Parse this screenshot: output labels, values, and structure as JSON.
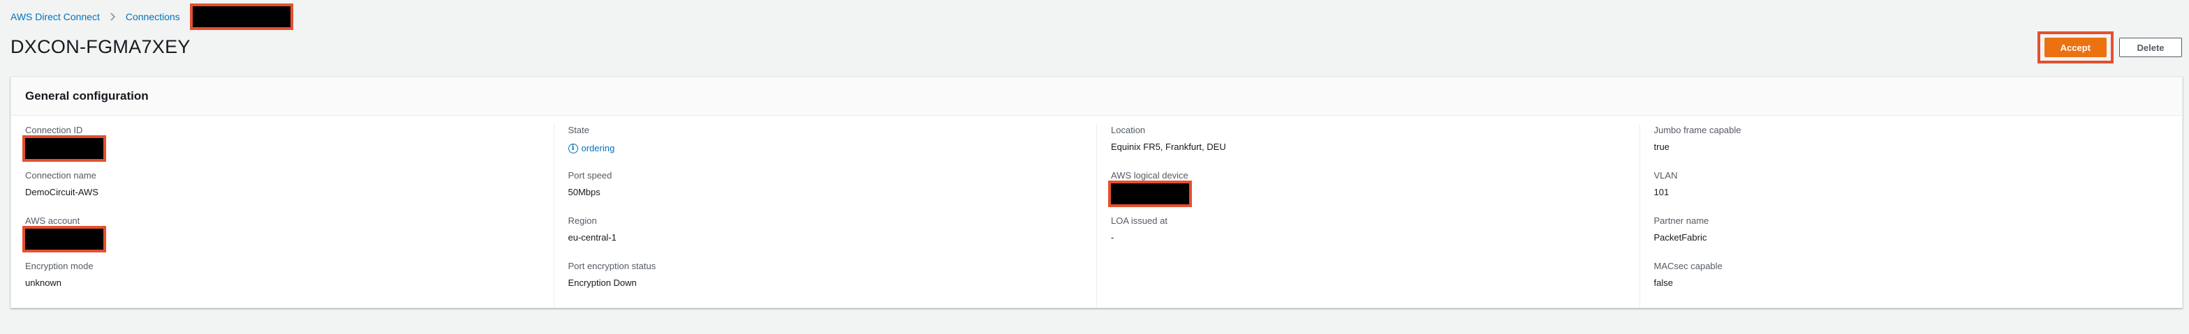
{
  "breadcrumb": {
    "items": [
      "AWS Direct Connect",
      "Connections"
    ]
  },
  "page": {
    "title": "DXCON-FGMA7XEY"
  },
  "actions": {
    "accept_label": "Accept",
    "delete_label": "Delete"
  },
  "panel": {
    "title": "General configuration",
    "columns": [
      [
        {
          "label": "Connection ID",
          "value": null,
          "redacted": true
        },
        {
          "label": "Connection name",
          "value": "DemoCircuit-AWS"
        },
        {
          "label": "AWS account",
          "value": null,
          "redacted": true
        },
        {
          "label": "Encryption mode",
          "value": "unknown"
        }
      ],
      [
        {
          "label": "State",
          "value": "ordering",
          "status": true
        },
        {
          "label": "Port speed",
          "value": "50Mbps"
        },
        {
          "label": "Region",
          "value": "eu-central-1"
        },
        {
          "label": "Port encryption status",
          "value": "Encryption Down"
        }
      ],
      [
        {
          "label": "Location",
          "value": "Equinix FR5, Frankfurt, DEU"
        },
        {
          "label": "AWS logical device",
          "value": null,
          "redacted": true
        },
        {
          "label": "LOA issued at",
          "value": "-"
        }
      ],
      [
        {
          "label": "Jumbo frame capable",
          "value": "true"
        },
        {
          "label": "VLAN",
          "value": "101"
        },
        {
          "label": "Partner name",
          "value": "PacketFabric"
        },
        {
          "label": "MACsec capable",
          "value": "false"
        }
      ]
    ]
  },
  "colors": {
    "link": "#0073bb",
    "primary": "#ec7211",
    "highlight": "#e4502f"
  },
  "icons": {
    "breadcrumb_separator": "chevron-right-icon",
    "state": "info-icon"
  }
}
